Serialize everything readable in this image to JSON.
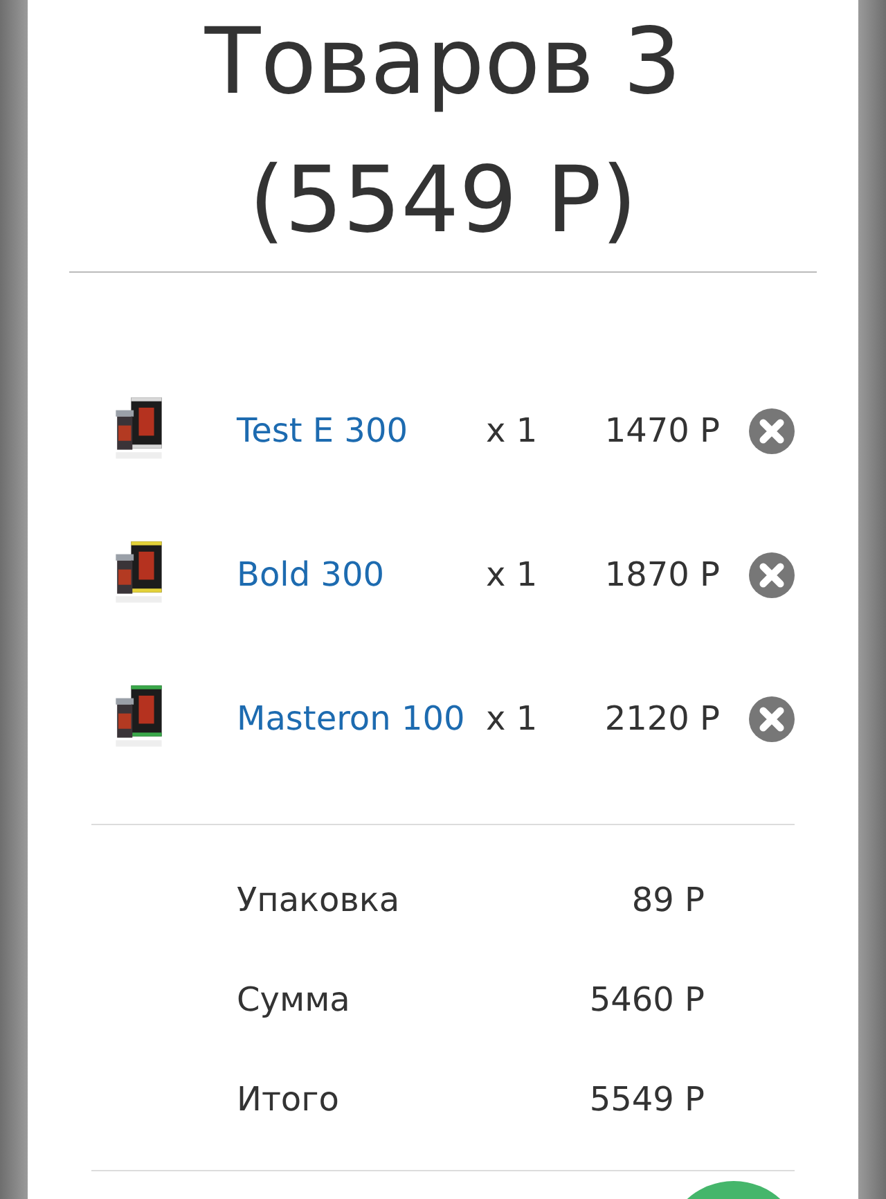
{
  "cart": {
    "title_line_1": "Товаров 3",
    "title_line_2": "(5549 Р)"
  },
  "items": [
    {
      "name": "Test E 300",
      "quantity": "x 1",
      "price": "1470 Р"
    },
    {
      "name": "Bold 300",
      "quantity": "x 1",
      "price": "1870 Р"
    },
    {
      "name": "Masteron 100",
      "quantity": "x 1",
      "price": "2120 Р"
    }
  ],
  "summary": [
    {
      "label": "Упаковка",
      "value": "89 Р"
    },
    {
      "label": "Сумма",
      "value": "5460 Р"
    },
    {
      "label": "Итого",
      "value": "5549 Р"
    }
  ]
}
